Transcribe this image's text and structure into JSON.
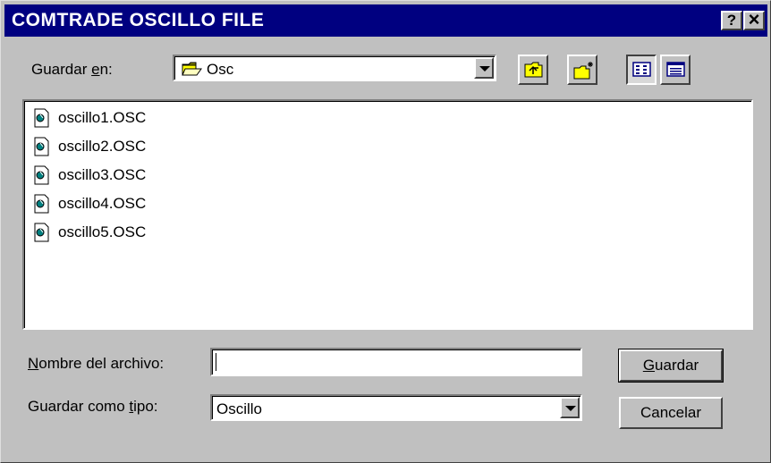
{
  "window": {
    "title": "COMTRADE OSCILLO FILE",
    "help_label": "?",
    "close_label": "×"
  },
  "save_in": {
    "label_pre": "Guardar ",
    "label_accel": "e",
    "label_post": "n:",
    "value": "Osc"
  },
  "toolbar": {
    "icons": [
      "up-one-level-icon",
      "create-new-folder-icon",
      "list-view-icon",
      "details-view-icon"
    ]
  },
  "files": [
    {
      "name": "oscillo1.OSC"
    },
    {
      "name": "oscillo2.OSC"
    },
    {
      "name": "oscillo3.OSC"
    },
    {
      "name": "oscillo4.OSC"
    },
    {
      "name": "oscillo5.OSC"
    }
  ],
  "filename": {
    "label_accel": "N",
    "label_post": "ombre del archivo:",
    "value": ""
  },
  "filetype": {
    "label_pre": "Guardar como ",
    "label_accel": "t",
    "label_post": "ipo:",
    "value": "Oscillo"
  },
  "buttons": {
    "save_accel": "G",
    "save_post": "uardar",
    "cancel": "Cancelar"
  },
  "colors": {
    "titlebar": "#000080",
    "face": "#c0c0c0"
  }
}
